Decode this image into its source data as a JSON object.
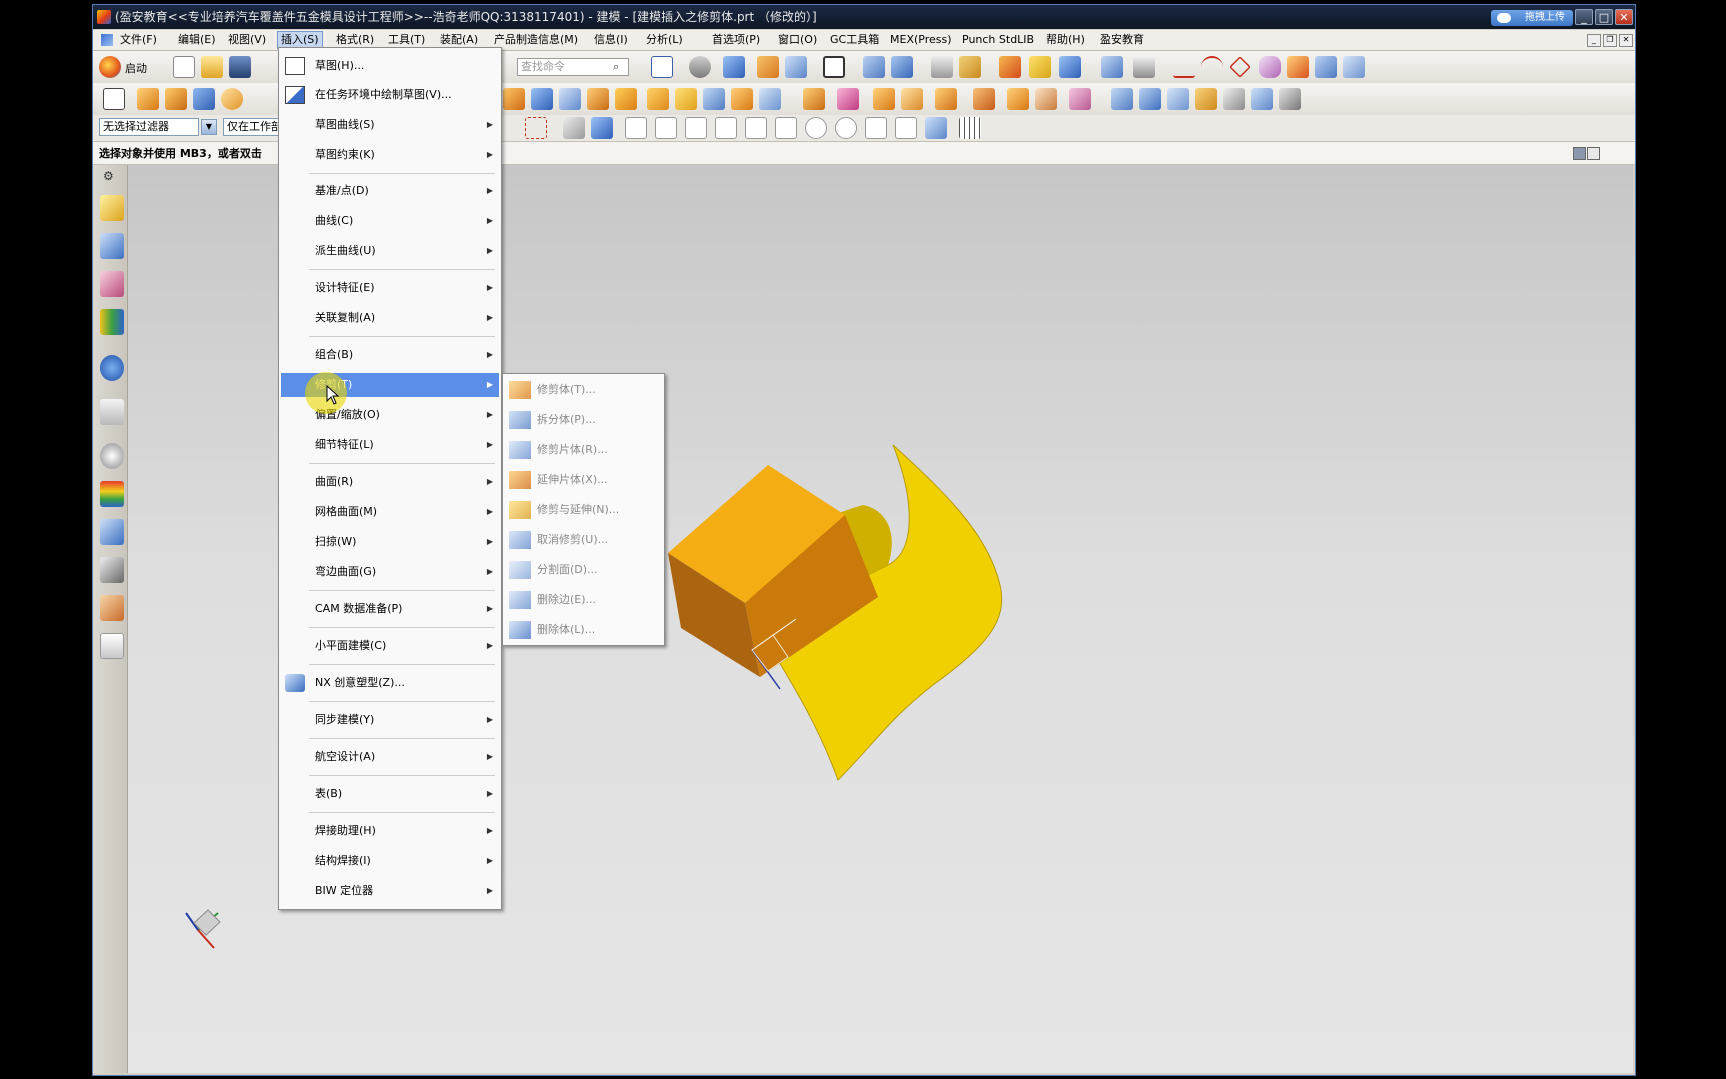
{
  "window": {
    "title": "(盈安教育<<专业培养汽车覆盖件五金模具设计工程师>>--浩奇老师QQ:3138117401) - 建模 - [建模插入之修剪体.prt （修改的）]",
    "upload_label": "拖拽上传"
  },
  "menubar": {
    "items": [
      "文件(F)",
      "编辑(E)",
      "视图(V)",
      "插入(S)",
      "格式(R)",
      "工具(T)",
      "装配(A)",
      "产品制造信息(M)",
      "信息(I)",
      "分析(L)",
      "首选项(P)",
      "窗口(O)",
      "GC工具箱",
      "MEX(Press)",
      "Punch StdLIB",
      "帮助(H)",
      "盈安教育"
    ],
    "active_index": 3
  },
  "toolbar": {
    "start_label": "启动",
    "search_placeholder": "查找命令"
  },
  "filterbar": {
    "type_filter": "无选择过滤器",
    "scope_filter": "仅在工作部"
  },
  "status": {
    "prompt": "选择对象并使用 MB3，或者双击"
  },
  "insert_menu": {
    "items": [
      {
        "label": "草图(H)...",
        "has_sub": false,
        "icon": "sketch-icon"
      },
      {
        "label": "在任务环境中绘制草图(V)...",
        "has_sub": false,
        "icon": "task-sketch-icon"
      },
      {
        "label": "草图曲线(S)",
        "has_sub": true
      },
      {
        "label": "草图约束(K)",
        "has_sub": true
      },
      {
        "label": "基准/点(D)",
        "has_sub": true
      },
      {
        "label": "曲线(C)",
        "has_sub": true
      },
      {
        "label": "派生曲线(U)",
        "has_sub": true
      },
      {
        "label": "设计特征(E)",
        "has_sub": true
      },
      {
        "label": "关联复制(A)",
        "has_sub": true
      },
      {
        "label": "组合(B)",
        "has_sub": true
      },
      {
        "label": "修剪(T)",
        "has_sub": true
      },
      {
        "label": "偏置/缩放(O)",
        "has_sub": true
      },
      {
        "label": "细节特征(L)",
        "has_sub": true
      },
      {
        "label": "曲面(R)",
        "has_sub": true
      },
      {
        "label": "网格曲面(M)",
        "has_sub": true
      },
      {
        "label": "扫掠(W)",
        "has_sub": true
      },
      {
        "label": "弯边曲面(G)",
        "has_sub": true
      },
      {
        "label": "CAM 数据准备(P)",
        "has_sub": true
      },
      {
        "label": "小平面建模(C)",
        "has_sub": true
      },
      {
        "label": "NX 创意塑型(Z)...",
        "has_sub": false,
        "icon": "nx-realize-shape-icon"
      },
      {
        "label": "同步建模(Y)",
        "has_sub": true
      },
      {
        "label": "航空设计(A)",
        "has_sub": true
      },
      {
        "label": "表(B)",
        "has_sub": true
      },
      {
        "label": "焊接助理(H)",
        "has_sub": true
      },
      {
        "label": "结构焊接(I)",
        "has_sub": true
      },
      {
        "label": "BIW 定位器",
        "has_sub": true
      }
    ],
    "highlighted_index": 10
  },
  "trim_submenu": {
    "items": [
      {
        "label": "修剪体(T)...",
        "icon": "trim-body-icon"
      },
      {
        "label": "拆分体(P)...",
        "icon": "split-body-icon"
      },
      {
        "label": "修剪片体(R)...",
        "icon": "trim-sheet-icon"
      },
      {
        "label": "延伸片体(X)...",
        "icon": "extend-sheet-icon"
      },
      {
        "label": "修剪与延伸(N)...",
        "icon": "trim-extend-icon"
      },
      {
        "label": "取消修剪(U)...",
        "icon": "untrim-icon"
      },
      {
        "label": "分割面(D)...",
        "icon": "divide-face-icon"
      },
      {
        "label": "删除边(E)...",
        "icon": "delete-edge-icon"
      },
      {
        "label": "删除体(L)...",
        "icon": "delete-body-icon"
      }
    ]
  },
  "colors": {
    "menu_highlight": "#5b8ee6",
    "sheet_body": "#f2d400",
    "block_body": "#e49a12",
    "titlebar": "#16223a"
  }
}
